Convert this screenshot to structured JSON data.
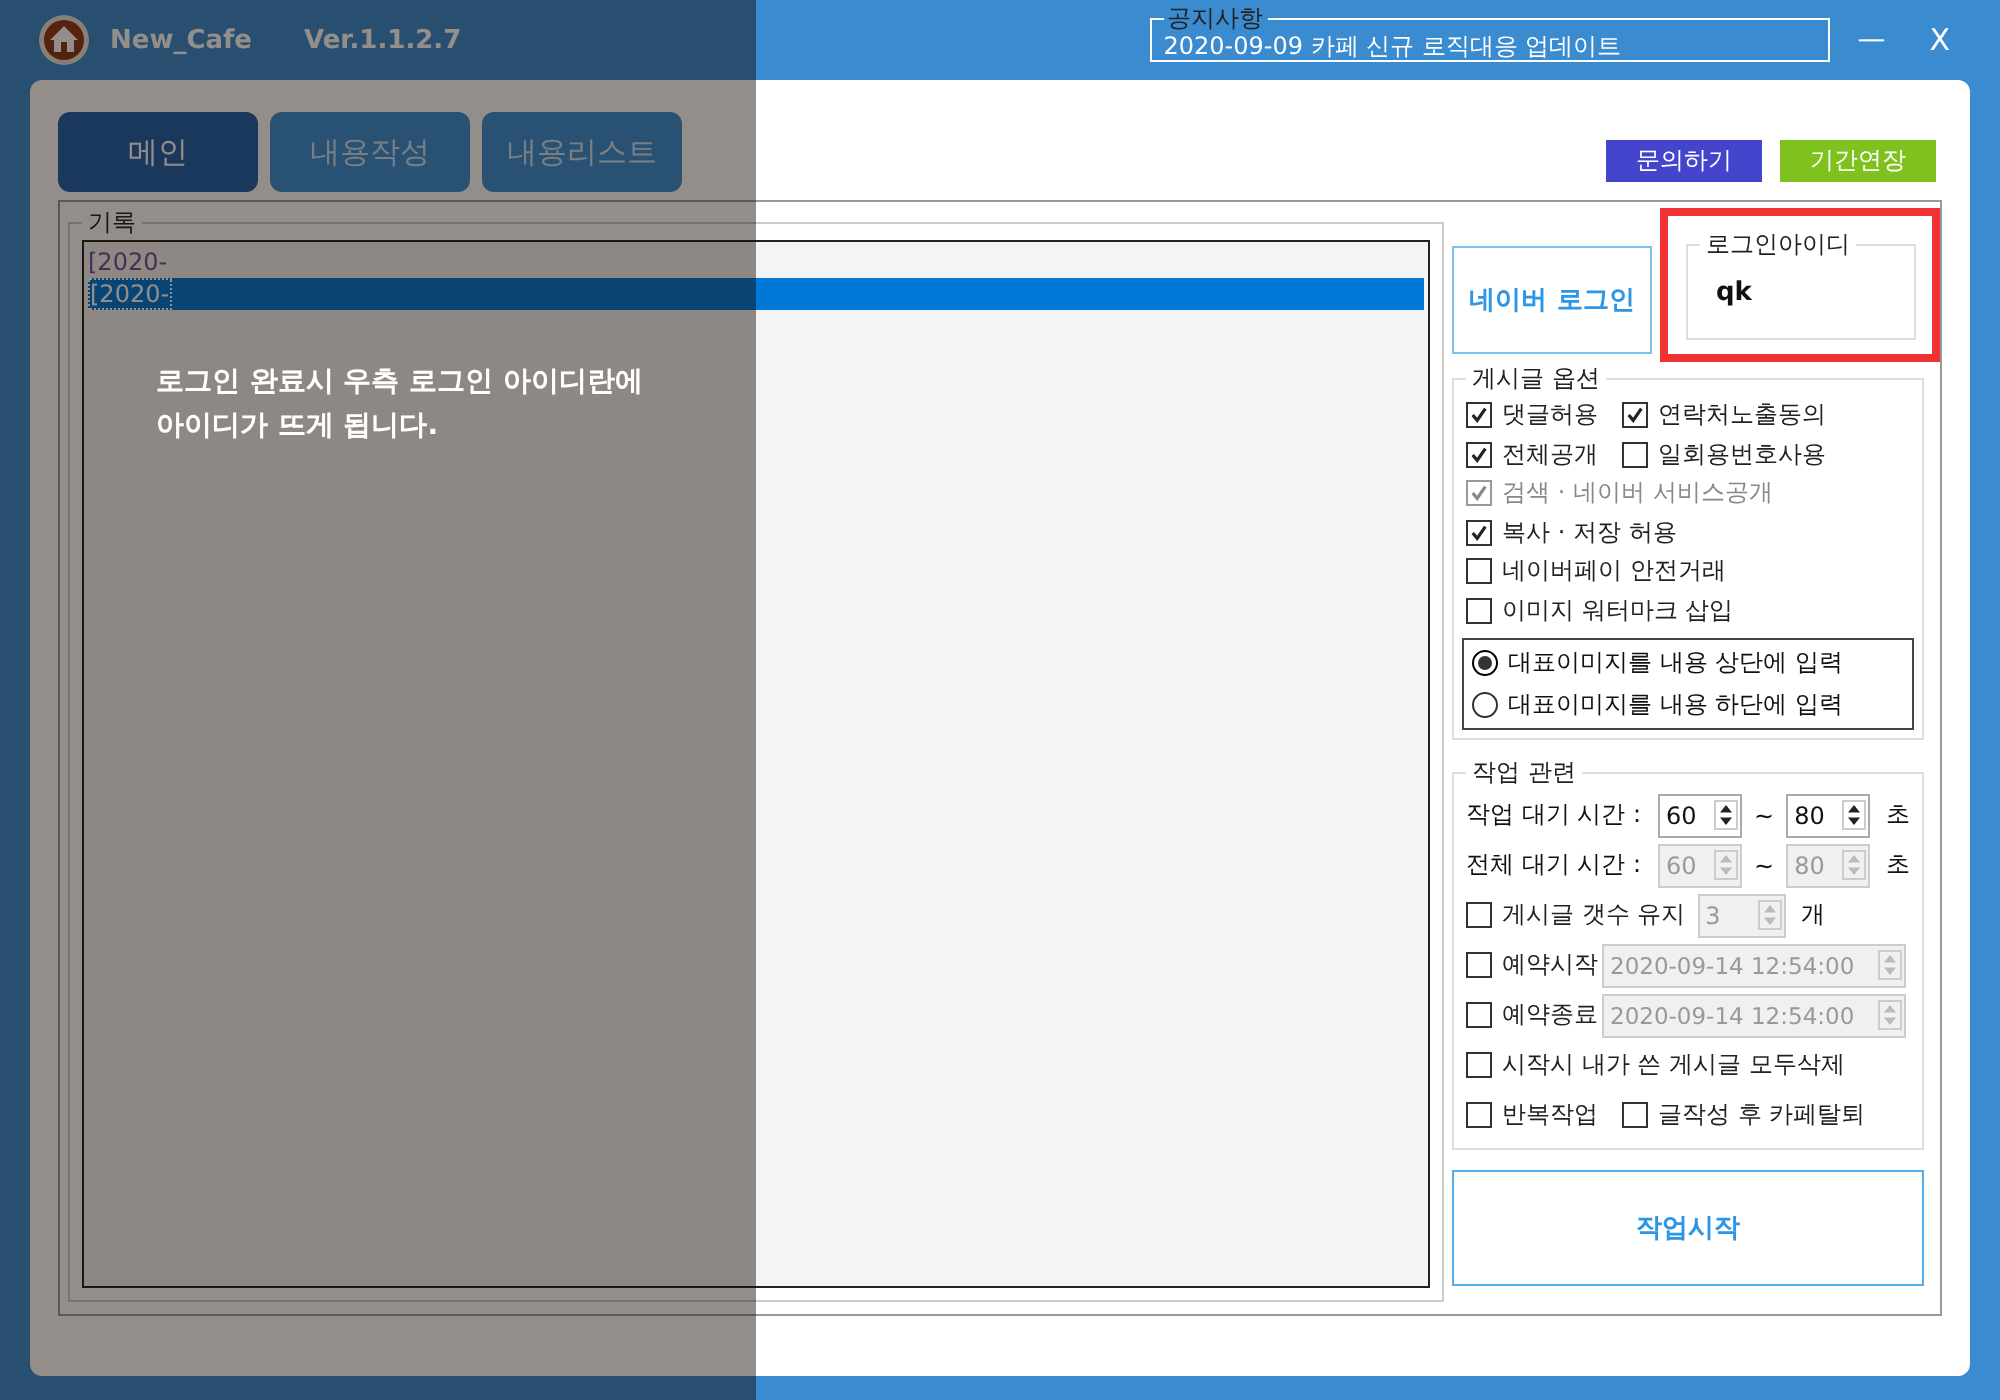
{
  "app": {
    "name": "New_Cafe",
    "version": "Ver.1.1.2.7"
  },
  "notice": {
    "label": "공지사항",
    "text": "2020-09-09 카페 신규 로직대응 업데이트"
  },
  "window_controls": [
    {
      "kind": "minimize",
      "label": "—"
    },
    {
      "kind": "close",
      "label": "X"
    }
  ],
  "tabs": [
    {
      "label": "메인",
      "selected": true
    },
    {
      "label": "내용작성",
      "selected": false
    },
    {
      "label": "내용리스트",
      "selected": false
    }
  ],
  "top_buttons": [
    {
      "label": "문의하기",
      "color": "#4444cc"
    },
    {
      "label": "기간연장",
      "color": "#7fc21e"
    }
  ],
  "log": {
    "label": "기록",
    "entries": [
      {
        "text": "[2020-",
        "selected": false
      },
      {
        "text": "[2020-",
        "selected": true
      }
    ]
  },
  "naver_login": "네이버 로그인",
  "login_id": {
    "label": "로그인아이디",
    "value": "qk",
    "highlighted": true
  },
  "post_options": {
    "label": "게시글 옵션",
    "rows": [
      [
        {
          "label": "댓글허용",
          "checked": true,
          "disabled": false
        },
        {
          "label": "연락처노출동의",
          "checked": true,
          "disabled": false
        }
      ],
      [
        {
          "label": "전체공개",
          "checked": true,
          "disabled": false
        },
        {
          "label": "일회용번호사용",
          "checked": false,
          "disabled": false
        }
      ],
      [
        {
          "label": "검색 · 네이버 서비스공개",
          "checked": true,
          "disabled": true
        }
      ],
      [
        {
          "label": "복사 · 저장 허용",
          "checked": true,
          "disabled": false
        }
      ],
      [
        {
          "label": "네이버페이 안전거래",
          "checked": false,
          "disabled": false
        }
      ],
      [
        {
          "label": "이미지 워터마크 삽입",
          "checked": false,
          "disabled": false
        }
      ]
    ],
    "radios": [
      {
        "label": "대표이미지를 내용 상단에 입력",
        "selected": true
      },
      {
        "label": "대표이미지를 내용 하단에 입력",
        "selected": false
      }
    ]
  },
  "work": {
    "label": "작업 관련",
    "wait_rows": [
      {
        "label": "작업 대기 시간 :",
        "from": "60",
        "sep": "~",
        "to": "80",
        "unit": "초",
        "disabled": false
      },
      {
        "label": "전체 대기 시간 :",
        "from": "60",
        "sep": "~",
        "to": "80",
        "unit": "초",
        "disabled": true
      }
    ],
    "keep_count": {
      "label": "게시글 갯수 유지",
      "checked": false,
      "value": "3",
      "unit": "개",
      "disabled": true
    },
    "schedule": [
      {
        "label": "예약시작",
        "checked": false,
        "value": "2020-09-14 12:54:00",
        "disabled": true
      },
      {
        "label": "예약종료",
        "checked": false,
        "value": "2020-09-14 12:54:00",
        "disabled": true
      }
    ],
    "rows": [
      [
        {
          "label": "시작시 내가 쓴 게시글 모두삭제",
          "checked": false
        }
      ],
      [
        {
          "label": "반복작업",
          "checked": false
        },
        {
          "label": "글작성 후 카페탈퇴",
          "checked": false
        }
      ]
    ]
  },
  "start_button": "작업시작",
  "tutorial": {
    "caption": "로그인 완료시 우측 로그인 아이디란에\n아이디가 뜨게 됩니다."
  }
}
